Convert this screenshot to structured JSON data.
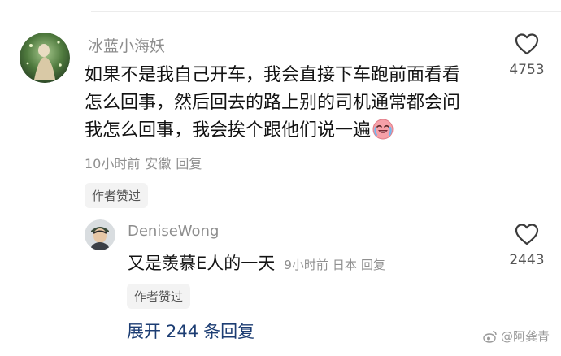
{
  "comment": {
    "username": "冰蓝小海妖",
    "lines": [
      "如果不是我自己开车，我会直接下车跑前面看看",
      "怎么回事，然后回去的路上别的司机通常都会问",
      "我怎么回事，我会挨个跟他们说一遍"
    ],
    "emoji": "crying-laugh-emoji",
    "time": "10小时前",
    "location": "安徽",
    "reply_label": "回复",
    "liked_by_author": "作者赞过",
    "like_count": "4753"
  },
  "reply": {
    "username": "DeniseWong",
    "text": "又是羡慕E人的一天",
    "time": "9小时前",
    "location": "日本",
    "reply_label": "回复",
    "liked_by_author": "作者赞过",
    "like_count": "2443"
  },
  "expand": {
    "prefix": "展开",
    "count": "244",
    "suffix": "条回复"
  },
  "watermark": "@阿龚青",
  "icons": {
    "like": "heart-outline-icon",
    "watermark": "weibo-logo-icon"
  },
  "colors": {
    "link": "#1c3d73",
    "meta": "#8f8f8f",
    "pill_bg": "#f3f3f3"
  }
}
